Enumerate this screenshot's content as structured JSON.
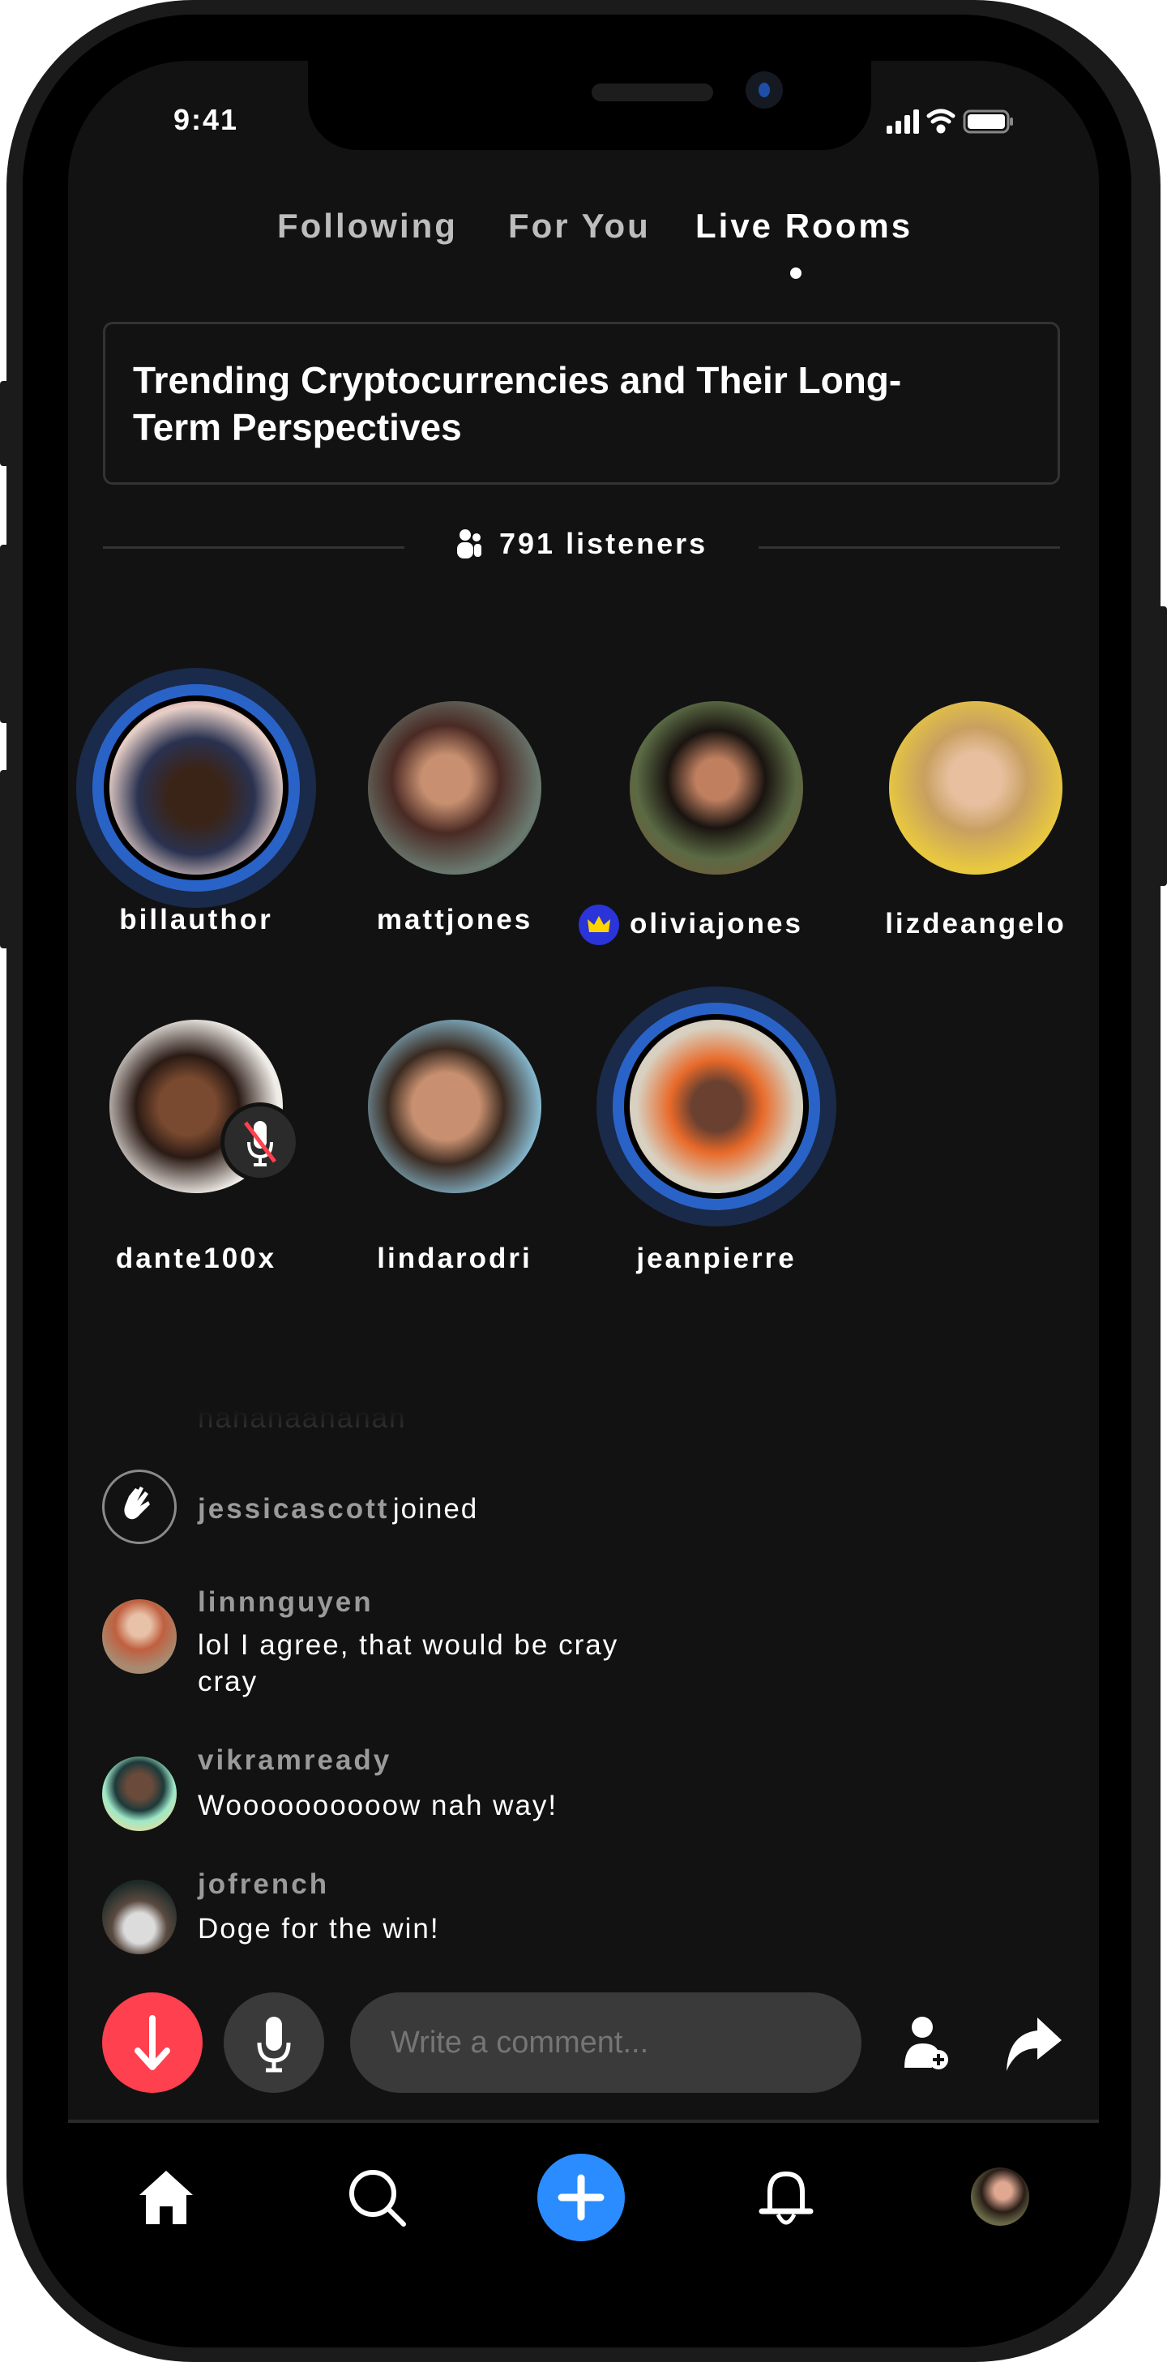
{
  "status_bar": {
    "time": "9:41"
  },
  "tabs": [
    {
      "label": "Following",
      "active": false
    },
    {
      "label": "For You",
      "active": false
    },
    {
      "label": "Live Rooms",
      "active": true
    }
  ],
  "room": {
    "title": "Trending Cryptocurrencies and Their Long-Term Perspectives",
    "listeners": "791 listeners"
  },
  "speakers": [
    {
      "name": "billauthor",
      "speaking": true
    },
    {
      "name": "mattjones"
    },
    {
      "name": "oliviajones",
      "badge": "crown-icon"
    },
    {
      "name": "lizdeangelo"
    },
    {
      "name": "dante100x",
      "muted": true
    },
    {
      "name": "lindarodri"
    },
    {
      "name": "jeanpierre",
      "speaking": true
    }
  ],
  "chat": [
    {
      "text": "hahahaahahah",
      "faded": true
    },
    {
      "name": "jessicascott",
      "text": "joined",
      "icon": "wave-hand-icon"
    },
    {
      "name": "linnnguyen",
      "text": "lol I agree, that would be cray cray"
    },
    {
      "name": "vikramready",
      "text": "Woooooooooow nah way!"
    },
    {
      "name": "jofrench",
      "text": "Doge for the win!"
    }
  ],
  "composer": {
    "placeholder": "Write a comment..."
  },
  "colors": {
    "accent": "#2a8cff",
    "leave": "#ff404e",
    "speaking_ring": "#2a63c7",
    "crown_badge": "#2b34d8",
    "crown": "#ffd400"
  }
}
